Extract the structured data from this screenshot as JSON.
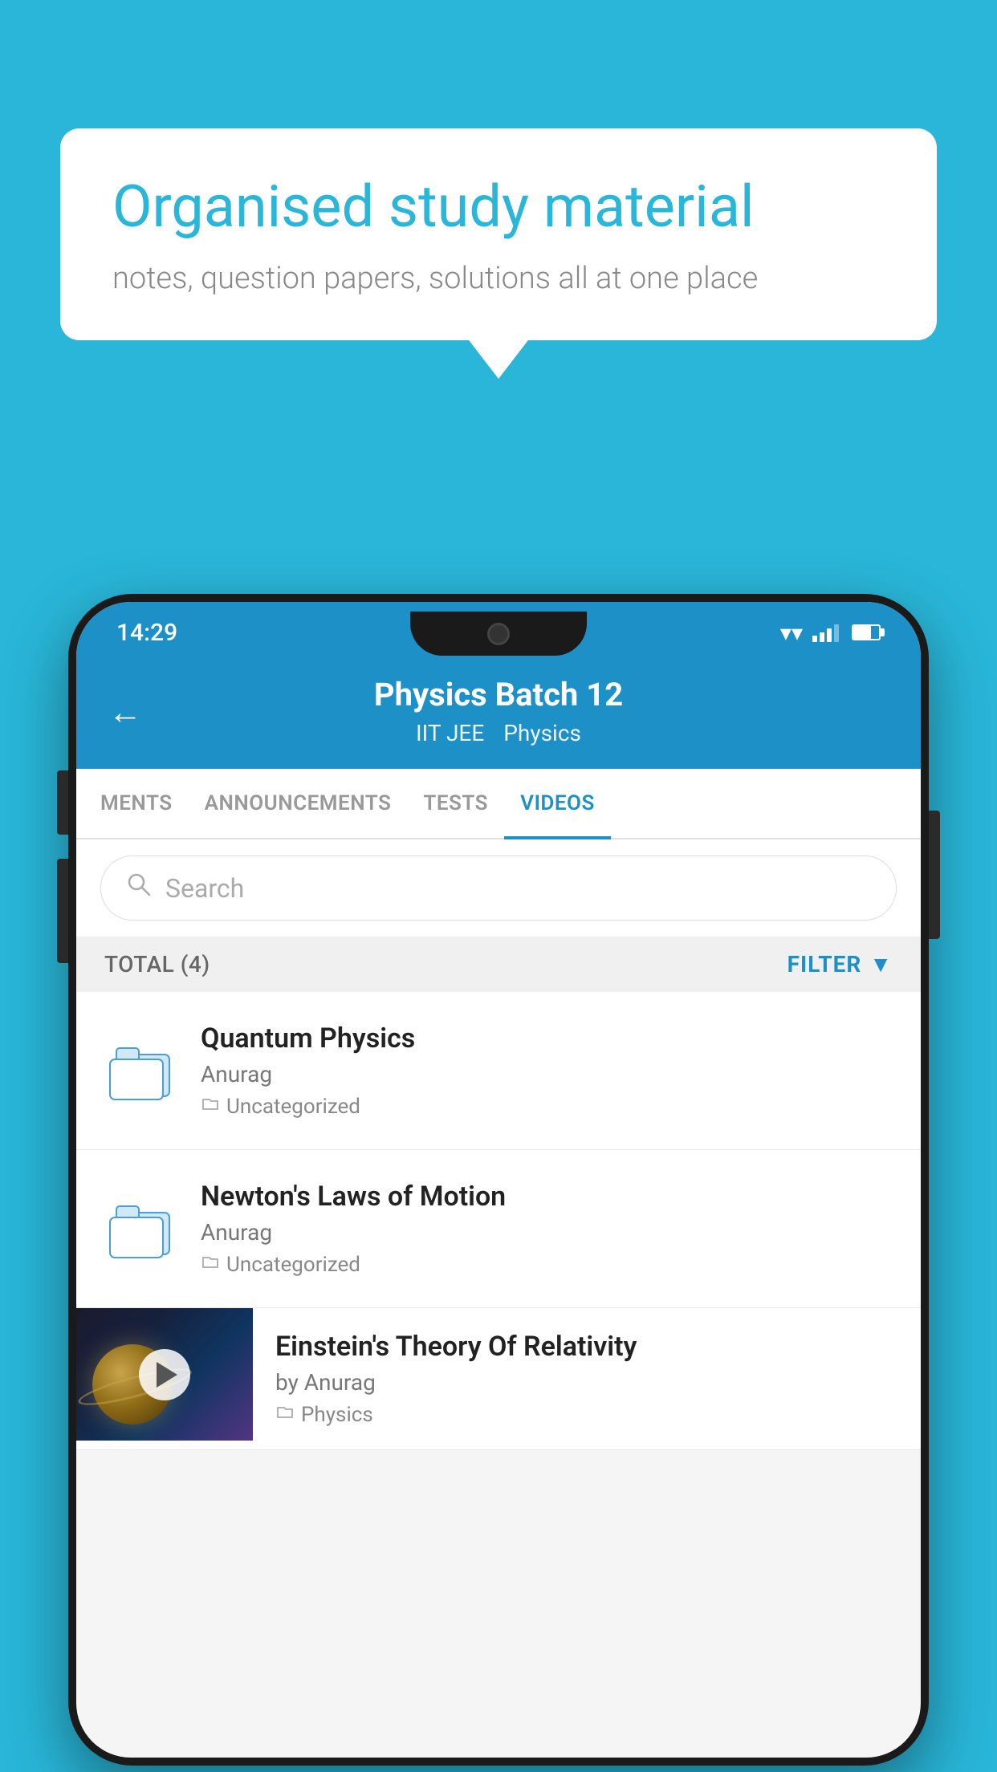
{
  "background_color": "#29b6d8",
  "bubble": {
    "title": "Organised study material",
    "subtitle": "notes, question papers, solutions all at one place"
  },
  "phone": {
    "status_bar": {
      "time": "14:29",
      "wifi": "▼",
      "battery_level": "70"
    },
    "header": {
      "title": "Physics Batch 12",
      "tag1": "IIT JEE",
      "tag2": "Physics",
      "back_label": "←"
    },
    "tabs": [
      {
        "label": "MENTS",
        "active": false
      },
      {
        "label": "ANNOUNCEMENTS",
        "active": false
      },
      {
        "label": "TESTS",
        "active": false
      },
      {
        "label": "VIDEOS",
        "active": true
      }
    ],
    "search": {
      "placeholder": "Search"
    },
    "filter_bar": {
      "total_label": "TOTAL (4)",
      "filter_label": "FILTER"
    },
    "videos": [
      {
        "id": 1,
        "title": "Quantum Physics",
        "author": "Anurag",
        "tag": "Uncategorized",
        "has_thumbnail": false
      },
      {
        "id": 2,
        "title": "Newton's Laws of Motion",
        "author": "Anurag",
        "tag": "Uncategorized",
        "has_thumbnail": false
      },
      {
        "id": 3,
        "title": "Einstein's Theory Of Relativity",
        "author": "by Anurag",
        "tag": "Physics",
        "has_thumbnail": true
      }
    ]
  }
}
